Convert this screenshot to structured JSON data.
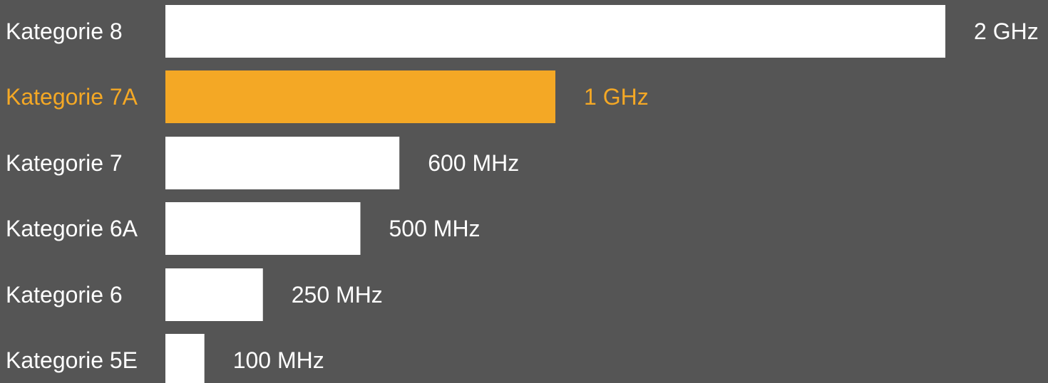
{
  "chart_data": {
    "type": "bar",
    "orientation": "horizontal",
    "categories": [
      "Kategorie 8",
      "Kategorie 7A",
      "Kategorie 7",
      "Kategorie 6A",
      "Kategorie 6",
      "Kategorie 5E"
    ],
    "values": [
      2000,
      1000,
      600,
      500,
      250,
      100
    ],
    "value_labels": [
      "2 GHz",
      "1 GHz",
      "600 MHz",
      "500 MHz",
      "250 MHz",
      "100 MHz"
    ],
    "unit": "MHz",
    "highlight_index": 1,
    "grid": false,
    "legend": "none"
  },
  "colors": {
    "background": "#555555",
    "bar": "#ffffff",
    "highlight": "#f4a825",
    "text": "#ffffff"
  }
}
